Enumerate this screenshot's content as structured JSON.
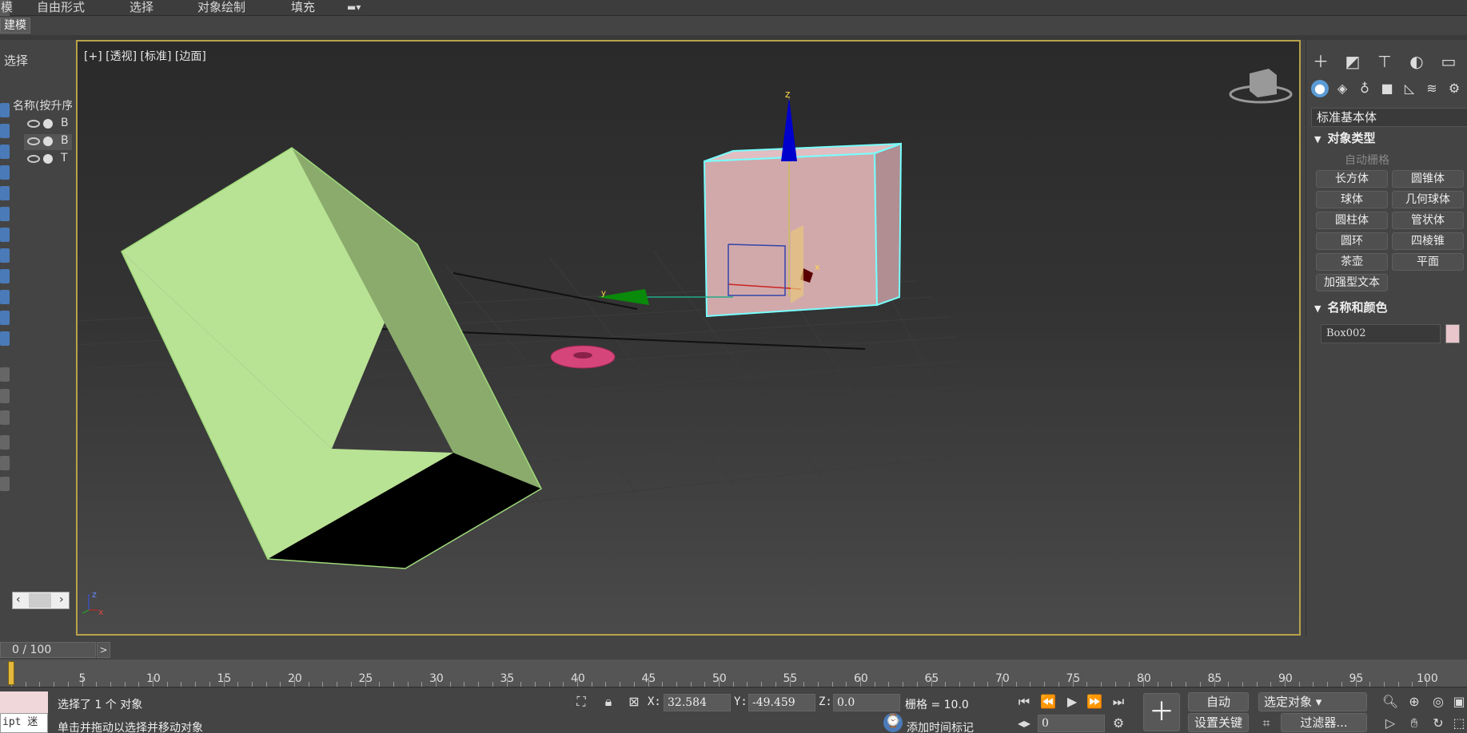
{
  "ribbon": {
    "tabs": [
      "模",
      "自由形式",
      "选择",
      "对象绘制",
      "填充"
    ],
    "subtab": "建模"
  },
  "scene_explorer": {
    "title": "选择",
    "name_header": "名称(按升序",
    "rows": [
      {
        "name": "B"
      },
      {
        "name": "B"
      },
      {
        "name": "T"
      }
    ]
  },
  "viewport": {
    "label": "[+] [透视] [标准] [边面]",
    "axis_z": "z",
    "axis_x": "x",
    "axis_y": "y"
  },
  "command_panel": {
    "category": "标准基本体",
    "object_type_title": "对象类型",
    "autogrid": "自动栅格",
    "buttons": [
      "长方体",
      "圆锥体",
      "球体",
      "几何球体",
      "圆柱体",
      "管状体",
      "圆环",
      "四棱锥",
      "茶壶",
      "平面",
      "加强型文本"
    ],
    "name_color_title": "名称和颜色",
    "object_name": "Box002",
    "object_color": "#e9c6cb"
  },
  "timeline": {
    "frame_display": "0 / 100",
    "next": ">",
    "ticks": [
      "5",
      "10",
      "15",
      "20",
      "25",
      "30",
      "35",
      "40",
      "45",
      "50",
      "55",
      "60",
      "65",
      "70",
      "75",
      "80",
      "85",
      "90",
      "95",
      "100"
    ]
  },
  "status": {
    "listener_text": "ipt 迷",
    "selection": "选择了 1 个 对象",
    "prompt": "单击并拖动以选择并移动对象",
    "x_label": "X:",
    "x_value": "32.584",
    "y_label": "Y:",
    "y_value": "-49.459",
    "z_label": "Z:",
    "z_value": "0.0",
    "grid": "栅格 = 10.0",
    "add_time_tag": "添加时间标记",
    "auto_key": "自动",
    "selected_objects": "选定对象",
    "set_key": "设置关键点",
    "filters": "过滤器...",
    "frame_field": "0"
  }
}
